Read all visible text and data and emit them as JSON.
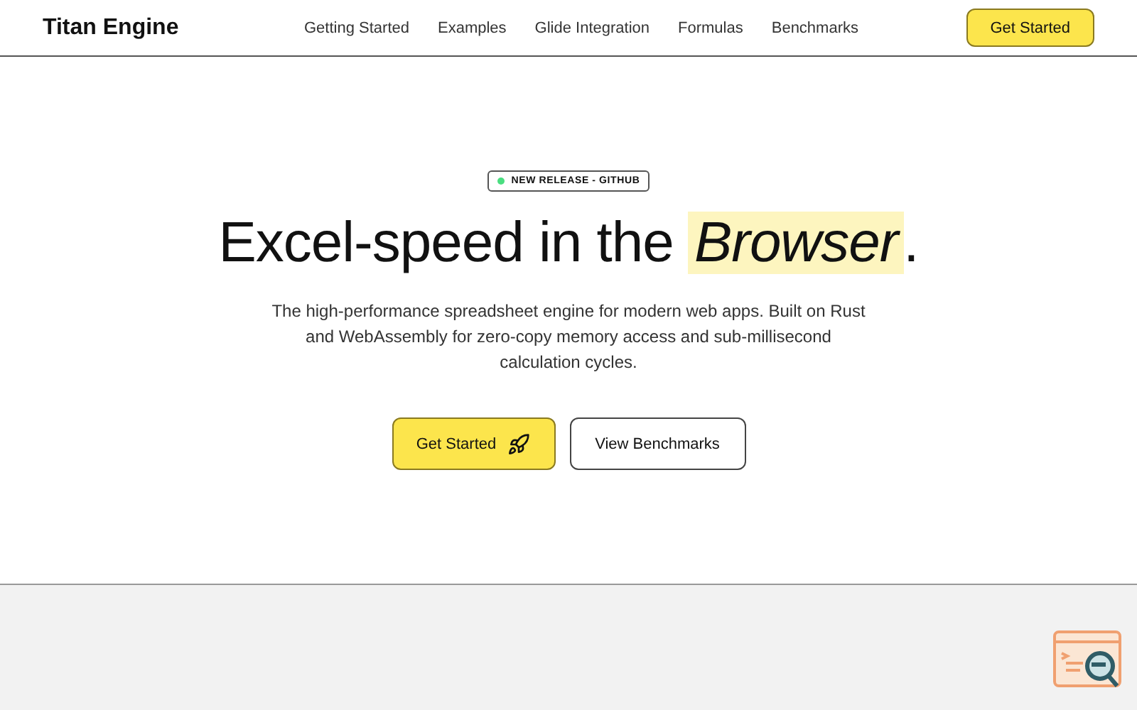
{
  "brand": "Titan Engine",
  "nav": [
    "Getting Started",
    "Examples",
    "Glide Integration",
    "Formulas",
    "Benchmarks"
  ],
  "header_button": "Get Started",
  "badge": {
    "label": "NEW RELEASE - GITHUB",
    "color": "#4ade80"
  },
  "headline": {
    "text": "Excel-speed in the ",
    "highlight": "Browser",
    "end": "."
  },
  "description": "The high-performance spreadsheet engine for modern web apps. Built on Rust and WebAssembly for zero-copy memory access and sub-millisecond calculation cycles.",
  "buttons": [
    {
      "label": "Get Started",
      "kind": "primary"
    },
    {
      "label": "View Benchmarks",
      "kind": "secondary"
    }
  ]
}
